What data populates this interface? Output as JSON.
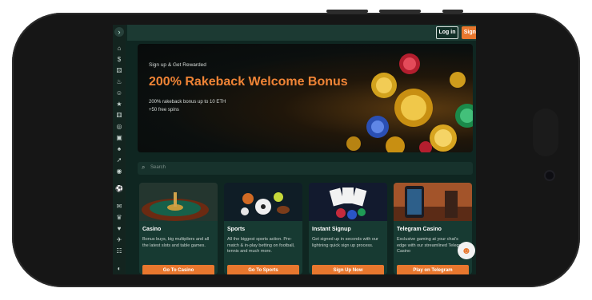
{
  "header": {
    "login_label": "Log in",
    "signup_label": "Sign Up",
    "sidebar_toggle": "›"
  },
  "sidebar": {
    "icons": [
      "home-icon",
      "dollar-icon",
      "dice-icon",
      "fire-icon",
      "users-icon",
      "star-icon",
      "dice-icon",
      "roulette-icon",
      "slots-icon",
      "spade-icon",
      "rocket-icon",
      "target-icon",
      "soccer-icon",
      "megaphone-icon",
      "trophy-icon",
      "heart-icon",
      "telegram-icon",
      "group-icon",
      "shield-icon"
    ]
  },
  "hero": {
    "eyebrow": "Sign up & Get Rewarded",
    "headline": "200% Rakeback Welcome Bonus",
    "line1": "200% rakeback bonus up to 10 ETH",
    "line2": "+50 free spins"
  },
  "search": {
    "placeholder": "Search"
  },
  "cards": [
    {
      "title": "Casino",
      "desc": "Bonus buys, big multipliers and all the latest slots and table games.",
      "button": "Go To Casino"
    },
    {
      "title": "Sports",
      "desc": "All the biggest sports action. Pre-match & in-play betting on football, tennis and much more.",
      "button": "Go To Sports"
    },
    {
      "title": "Instant Signup",
      "desc": "Get signed up in seconds with our lightning quick sign up process.",
      "button": "Sign Up Now"
    },
    {
      "title": "Telegram Casino",
      "desc": "Exclusive gaming at your chat's edge with our streamlined Telegram Casino",
      "button": "Play on Telegram"
    }
  ],
  "colors": {
    "accent": "#e8772e",
    "panel": "#173a32",
    "background": "#0f2621"
  }
}
